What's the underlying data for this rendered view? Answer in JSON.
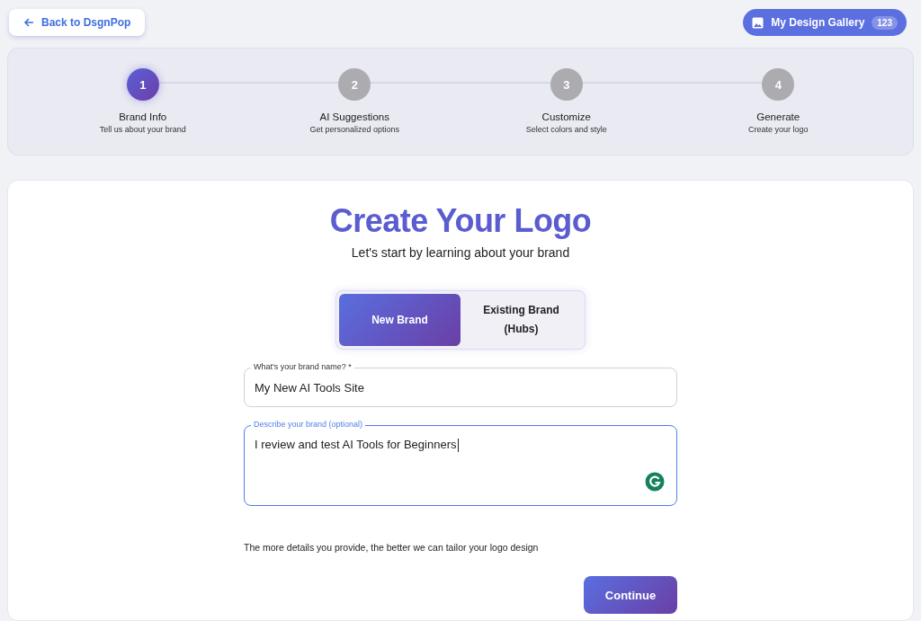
{
  "back_button": {
    "label": "Back to DsgnPop"
  },
  "gallery_button": {
    "label": "My Design Gallery",
    "count": "123"
  },
  "steps": [
    {
      "number": "1",
      "title": "Brand Info",
      "subtitle": "Tell us about your brand",
      "selected": true
    },
    {
      "number": "2",
      "title": "AI Suggestions",
      "subtitle": "Get personalized options",
      "selected": false
    },
    {
      "number": "3",
      "title": "Customize",
      "subtitle": "Select colors and style",
      "selected": false
    },
    {
      "number": "4",
      "title": "Generate",
      "subtitle": "Create your logo",
      "selected": false
    }
  ],
  "heading": "Create Your Logo",
  "subheading": "Let's start by learning about your brand",
  "brand_toggle": [
    {
      "label": "New Brand",
      "selected": true
    },
    {
      "label": "Existing Brand (Hubs)",
      "selected": false
    }
  ],
  "fields": [
    {
      "kind": "input",
      "label": "What's your brand name? *",
      "value": "My New AI Tools Site",
      "focused": false
    },
    {
      "kind": "textarea",
      "label": "Describe your brand (optional)",
      "value": "I review and test AI Tools for Beginners",
      "focused": true
    }
  ],
  "hint": "The more details you provide, the better we can tailor your logo design",
  "continue_button": {
    "label": "Continue"
  }
}
